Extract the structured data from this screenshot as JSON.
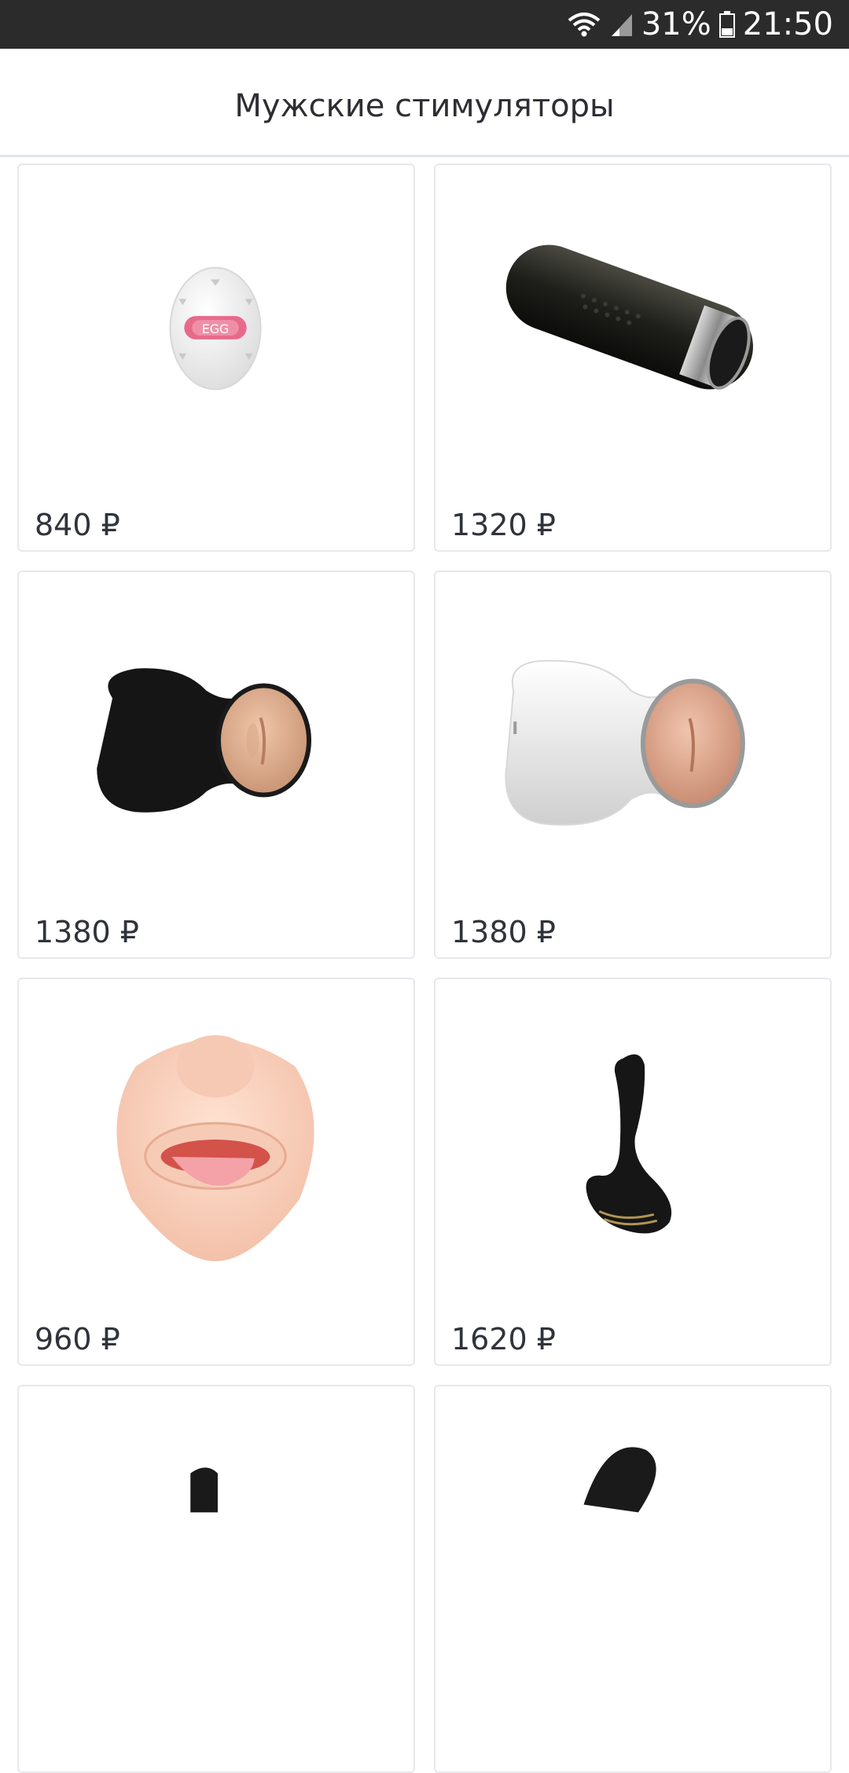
{
  "status_bar": {
    "battery": "31%",
    "time": "21:50",
    "icons": [
      "wifi-icon",
      "signal-icon",
      "battery-icon"
    ]
  },
  "header": {
    "title": "Мужские стимуляторы"
  },
  "products": [
    {
      "price": "840 ₽",
      "image": "egg-masturbator-image"
    },
    {
      "price": "1320 ₽",
      "image": "black-cylinder-masturbator-image"
    },
    {
      "price": "1380 ₽",
      "image": "black-vagina-masturbator-image"
    },
    {
      "price": "1380 ₽",
      "image": "white-vagina-masturbator-image"
    },
    {
      "price": "960 ₽",
      "image": "mouth-masturbator-image"
    },
    {
      "price": "1620 ₽",
      "image": "prostate-massager-image"
    },
    {
      "price": "",
      "image": "partial-product-image"
    },
    {
      "price": "",
      "image": "partial-product-image"
    }
  ]
}
